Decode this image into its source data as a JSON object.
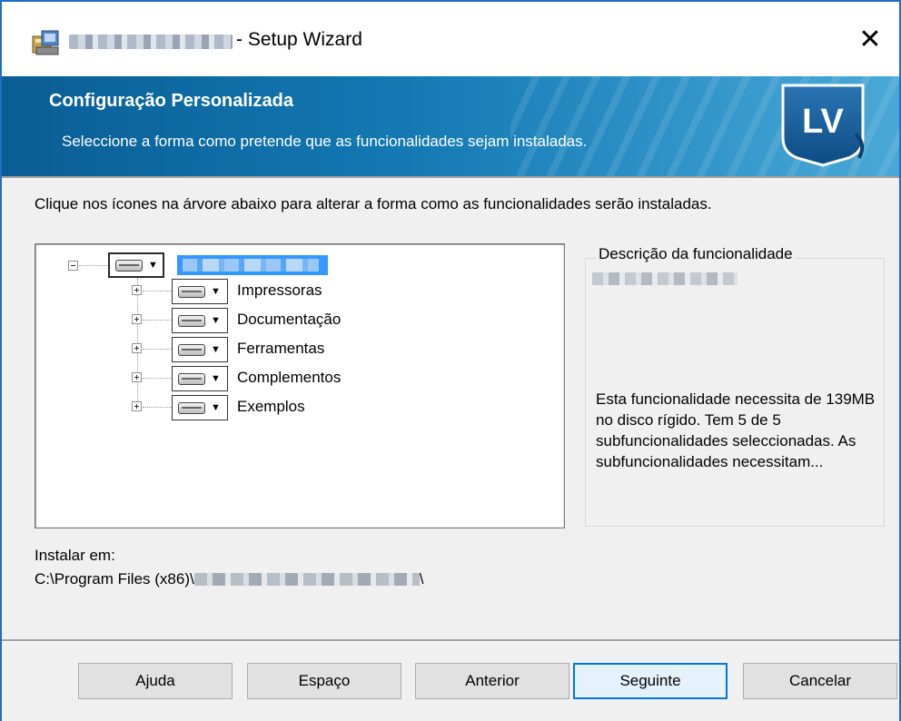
{
  "window": {
    "title_suffix": "- Setup Wizard",
    "close_glyph": "✕"
  },
  "banner": {
    "title": "Configuração Personalizada",
    "subtitle": "Seleccione a forma como pretende que as funcionalidades sejam instaladas.",
    "logo_text": "LV"
  },
  "main": {
    "instructions": "Clique nos ícones na árvore abaixo para alterar a forma como as funcionalidades serão instaladas."
  },
  "tree": {
    "items": [
      {
        "label": "Impressoras"
      },
      {
        "label": "Documentação"
      },
      {
        "label": "Ferramentas"
      },
      {
        "label": "Complementos"
      },
      {
        "label": "Exemplos"
      }
    ]
  },
  "description": {
    "legend": "Descrição da funcionalidade",
    "text": "Esta funcionalidade necessita de 139MB no disco rígido. Tem 5 de 5 subfuncionalidades seleccionadas. As subfuncionalidades necessitam..."
  },
  "install": {
    "label": "Instalar em:",
    "path_prefix": "C:\\Program Files (x86)\\",
    "path_suffix": "\\"
  },
  "buttons": {
    "help": "Ajuda",
    "space": "Espaço",
    "back": "Anterior",
    "next": "Seguinte",
    "cancel": "Cancelar"
  },
  "colors": {
    "banner_dark": "#0a5d94",
    "banner_light": "#4aa8d6",
    "selection": "#3399ff",
    "default_button_border": "#0078d7"
  }
}
